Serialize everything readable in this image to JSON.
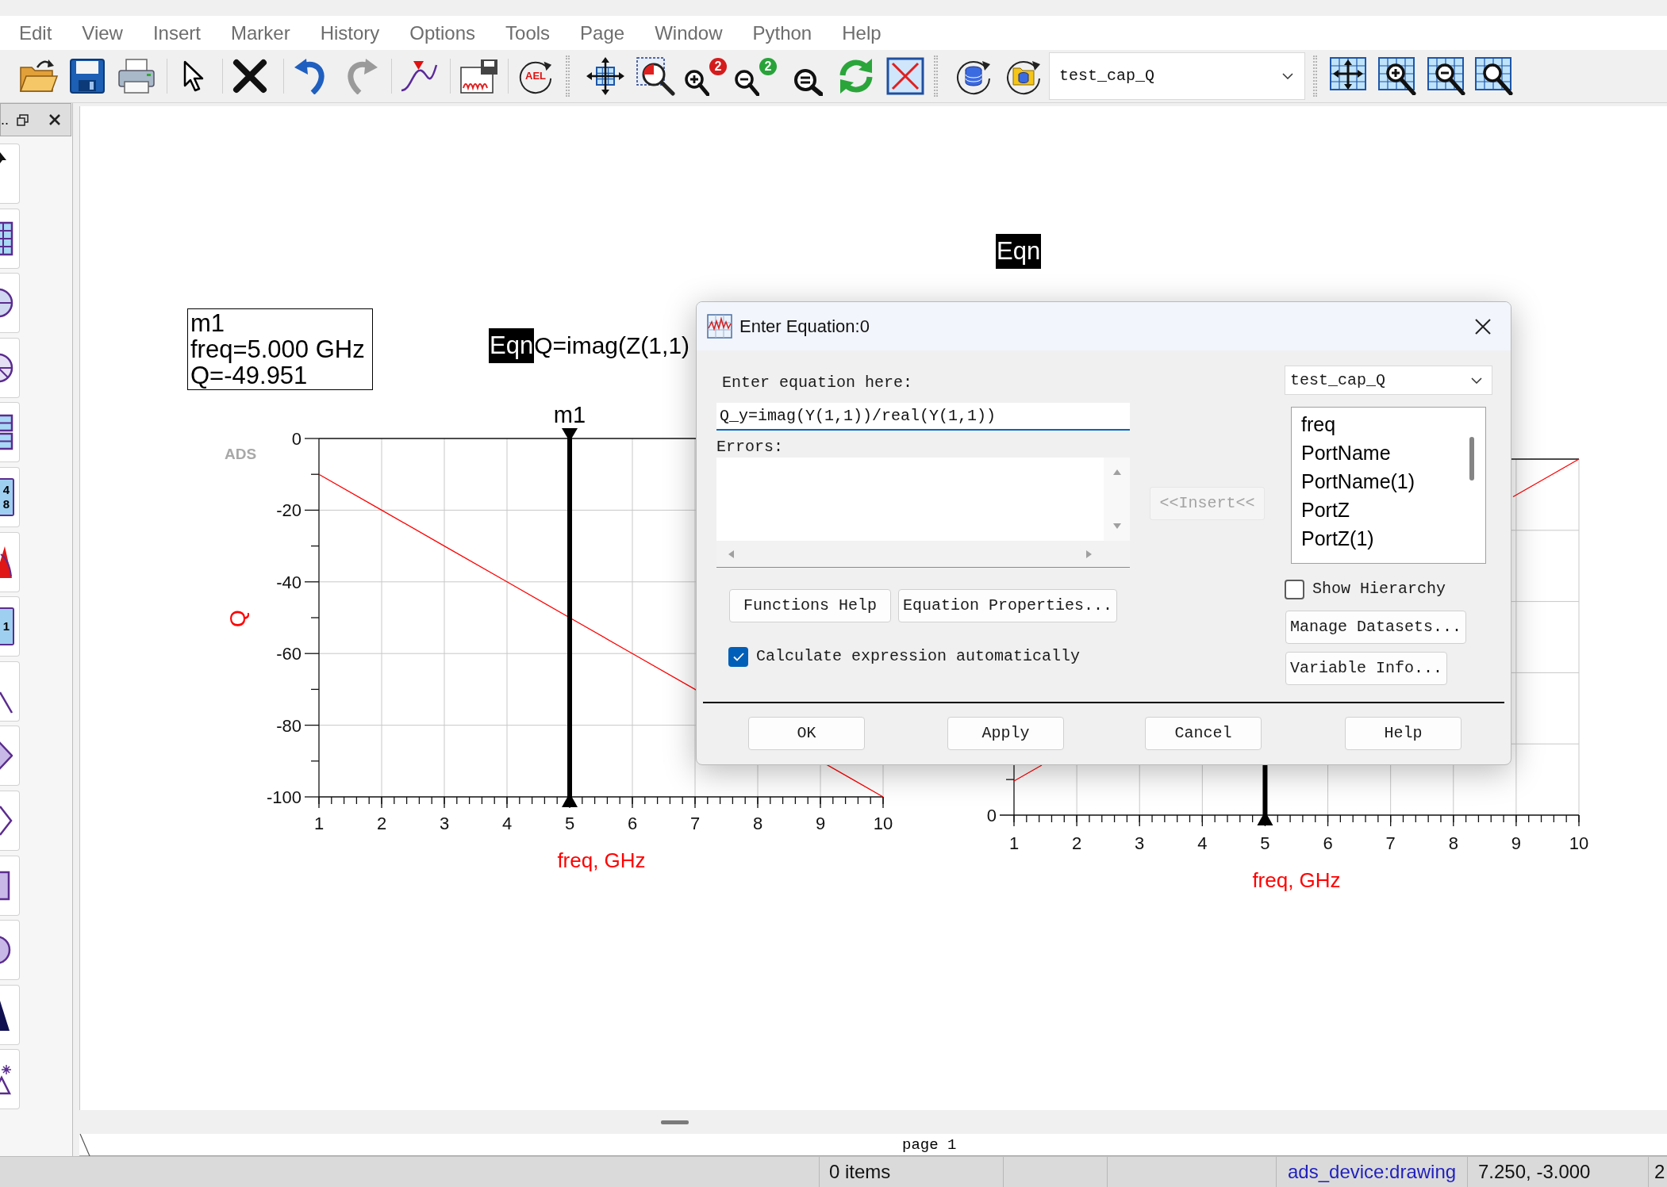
{
  "menu_bar": {
    "items": [
      "Edit",
      "View",
      "Insert",
      "Marker",
      "History",
      "Options",
      "Tools",
      "Page",
      "Window",
      "Python",
      "Help"
    ]
  },
  "toolbar": {
    "ael_label": "AEL",
    "zoom_badges": [
      "2",
      "2"
    ],
    "dataset": "test_cap_Q"
  },
  "palette": {
    "header": "..",
    "digit_tiles": [
      [
        "4",
        "8"
      ],
      [
        "1"
      ]
    ]
  },
  "canvas": {
    "marker_readout": [
      "m1",
      "freq=5.000 GHz",
      "Q=-49.951"
    ],
    "equations": [
      {
        "tag": "Eqn",
        "text": "Q=imag(Z(1,1)"
      },
      {
        "tag": "Eqn"
      }
    ],
    "left_plot": {
      "tag": "ADS",
      "chart_data": {
        "type": "line",
        "xlabel": "freq, GHz",
        "ylabel": "Q",
        "x": [
          1,
          2,
          3,
          4,
          5,
          6,
          7,
          9.5,
          10
        ],
        "series": [
          {
            "color": "#ff0000",
            "values": [
              -10,
              -20,
              -30,
              -40,
              -50,
              -60,
              -70,
              -95,
              -100
            ]
          }
        ],
        "xlim": [
          1,
          10
        ],
        "ylim": [
          -100,
          0
        ],
        "xticks": [
          1,
          2,
          3,
          4,
          5,
          6,
          7,
          8,
          9,
          10
        ],
        "yticks": [
          0,
          -20,
          -40,
          -60,
          -80,
          -100
        ],
        "grid": true,
        "ref_lines": [
          {
            "axis": "x",
            "value": 5,
            "label": "m1"
          }
        ]
      }
    },
    "right_plot": {
      "xlabel": "freq, GHz",
      "x_tick_labels": [
        "1",
        "2",
        "3",
        "4",
        "5",
        "6",
        "7",
        "8",
        "9",
        "10"
      ],
      "y_tick_labels": [
        "0"
      ]
    }
  },
  "page_tabs": [
    {
      "label": "page 1",
      "selected": true
    }
  ],
  "status_bar": {
    "items": "0 items",
    "mode": "ads_device:drawing",
    "coords": "7.250, -3.000",
    "field_5": "2"
  },
  "dialog": {
    "title": "Enter Equation:0",
    "equation": {
      "label": "Enter equation here:",
      "value": "Q_y=imag(Y(1,1))/real(Y(1,1))"
    },
    "errors": {
      "label": "Errors:"
    },
    "insert_button": {
      "label": "<<Insert<<",
      "disabled": true
    },
    "dataset": "test_cap_Q",
    "variables": [
      {
        "label": "freq",
        "selected": false
      },
      {
        "label": "PortName",
        "selected": false
      },
      {
        "label": "PortName(1)",
        "selected": false
      },
      {
        "label": "PortZ",
        "selected": false
      },
      {
        "label": "PortZ(1)",
        "selected": false
      }
    ],
    "show_hierarchy": {
      "label": "Show Hierarchy",
      "checked": false
    },
    "tool_buttons": [
      "Functions Help",
      "Equation Properties..."
    ],
    "auto_calculate": {
      "label": "Calculate expression automatically",
      "checked": true
    },
    "side_buttons": [
      "Manage Datasets...",
      "Variable Info..."
    ],
    "buttons": [
      "OK",
      "Apply",
      "Cancel",
      "Help"
    ]
  }
}
